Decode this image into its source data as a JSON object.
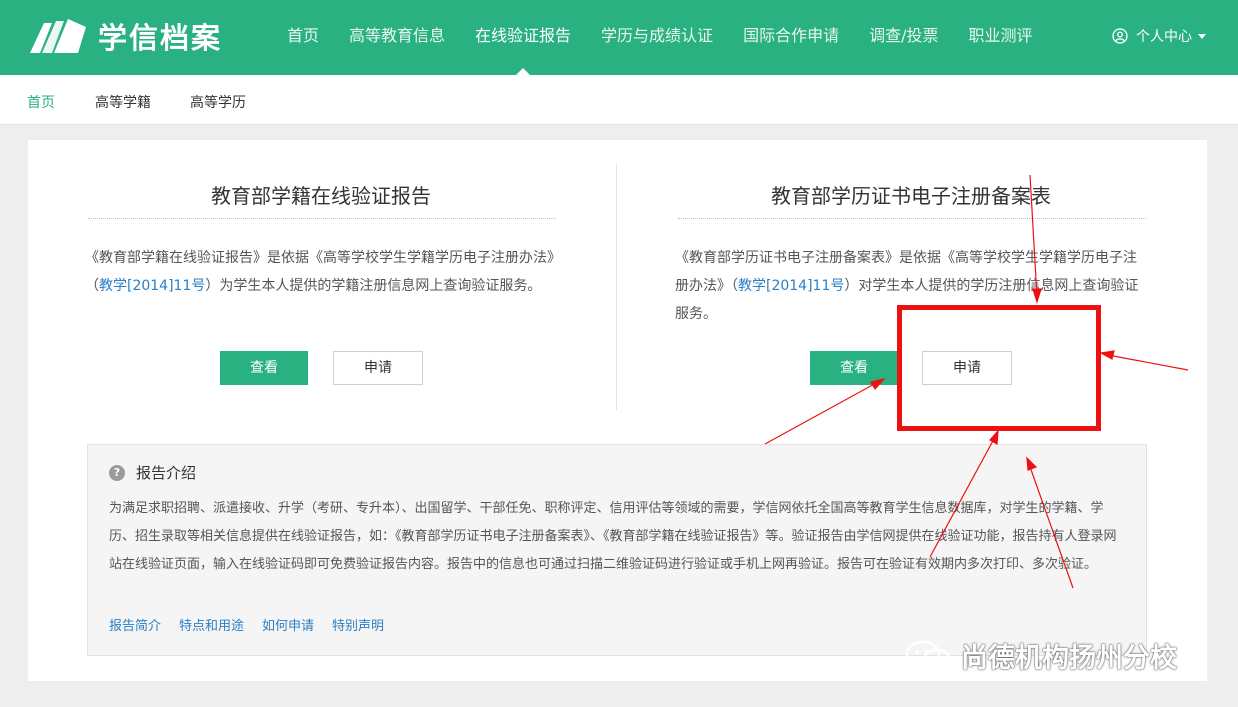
{
  "brand": {
    "name": "学信档案",
    "color": "#29b181"
  },
  "nav": {
    "items": [
      "首页",
      "高等教育信息",
      "在线验证报告",
      "学历与成绩认证",
      "国际合作申请",
      "调查/投票",
      "职业测评"
    ],
    "active_index": 2
  },
  "user_center": {
    "label": "个人中心",
    "icon": "user-circle-icon"
  },
  "subnav": {
    "items": [
      "首页",
      "高等学籍",
      "高等学历"
    ]
  },
  "left_panel": {
    "title": "教育部学籍在线验证报告",
    "desc_part1": "《教育部学籍在线验证报告》是依据《高等学校学生学籍学历电子注册办法》（",
    "desc_link": "教学[2014]11号",
    "desc_part2": "）为学生本人提供的学籍注册信息网上查询验证服务。",
    "btn_view": "查看",
    "btn_apply": "申请"
  },
  "right_panel": {
    "title": "教育部学历证书电子注册备案表",
    "desc_part1": "《教育部学历证书电子注册备案表》是依据《高等学校学生学籍学历电子注册办法》（",
    "desc_link": "教学[2014]11号",
    "desc_part2": "）对学生本人提供的学历注册信息网上查询验证服务。",
    "btn_view": "查看",
    "btn_apply": "申请"
  },
  "intro": {
    "title": "报告介绍",
    "icon": "question-circle-icon",
    "body": "为满足求职招聘、派遣接收、升学（考研、专升本）、出国留学、干部任免、职称评定、信用评估等领域的需要，学信网依托全国高等教育学生信息数据库，对学生的学籍、学历、招生录取等相关信息提供在线验证报告，如：《教育部学历证书电子注册备案表》、《教育部学籍在线验证报告》等。验证报告由学信网提供在线验证功能，报告持有人登录网站在线验证页面，输入在线验证码即可免费验证报告内容。报告中的信息也可通过扫描二维验证码进行验证或手机上网再验证。报告可在验证有效期内多次打印、多次验证。",
    "links": [
      "报告简介",
      "特点和用途",
      "如何申请",
      "特别声明"
    ]
  },
  "annotation_color": "#ee1111",
  "watermark": {
    "text": "尚德机构扬州分校",
    "icon": "wechat-icon"
  }
}
